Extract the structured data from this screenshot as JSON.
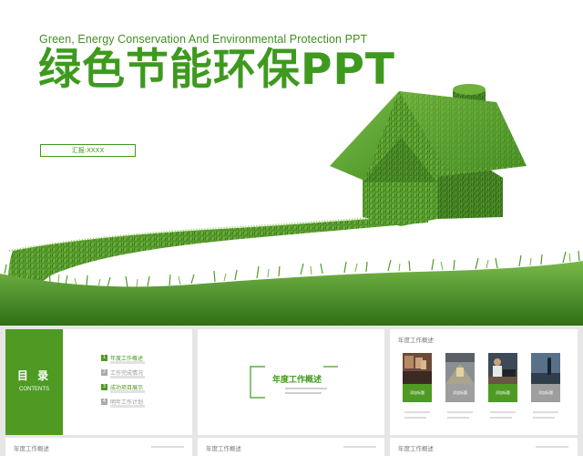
{
  "main_slide": {
    "subtitle_en": "Green, Energy Conservation And Environmental Protection PPT",
    "title_cn": "绿色节能环保PPT",
    "reporter": "汇报:XXXX"
  },
  "thumbnails": {
    "toc": {
      "title": "目 录",
      "subtitle": "CONTENTS",
      "items": [
        {
          "num": "1",
          "label": "年度工作概述",
          "active": true
        },
        {
          "num": "2",
          "label": "工作完成情况",
          "active": false
        },
        {
          "num": "3",
          "label": "成功项目展示",
          "active": true
        },
        {
          "num": "4",
          "label": "明年工作计划",
          "active": false
        }
      ]
    },
    "section": {
      "title": "年度工作概述"
    },
    "overview": {
      "header": "年度工作概述",
      "cards": [
        {
          "label": "添加标题",
          "color": "#4e9a22"
        },
        {
          "label": "添加标题",
          "color": "#9e9e9e"
        },
        {
          "label": "添加标题",
          "color": "#4e9a22"
        },
        {
          "label": "添加标题",
          "color": "#9e9e9e"
        }
      ]
    },
    "bottom": [
      {
        "header": "年度工作概述"
      },
      {
        "header": "年度工作概述"
      },
      {
        "header": "年度工作概述"
      }
    ]
  },
  "colors": {
    "brand_green": "#3e9a1e",
    "toc_green": "#4e9a22",
    "gray": "#9e9e9e"
  }
}
